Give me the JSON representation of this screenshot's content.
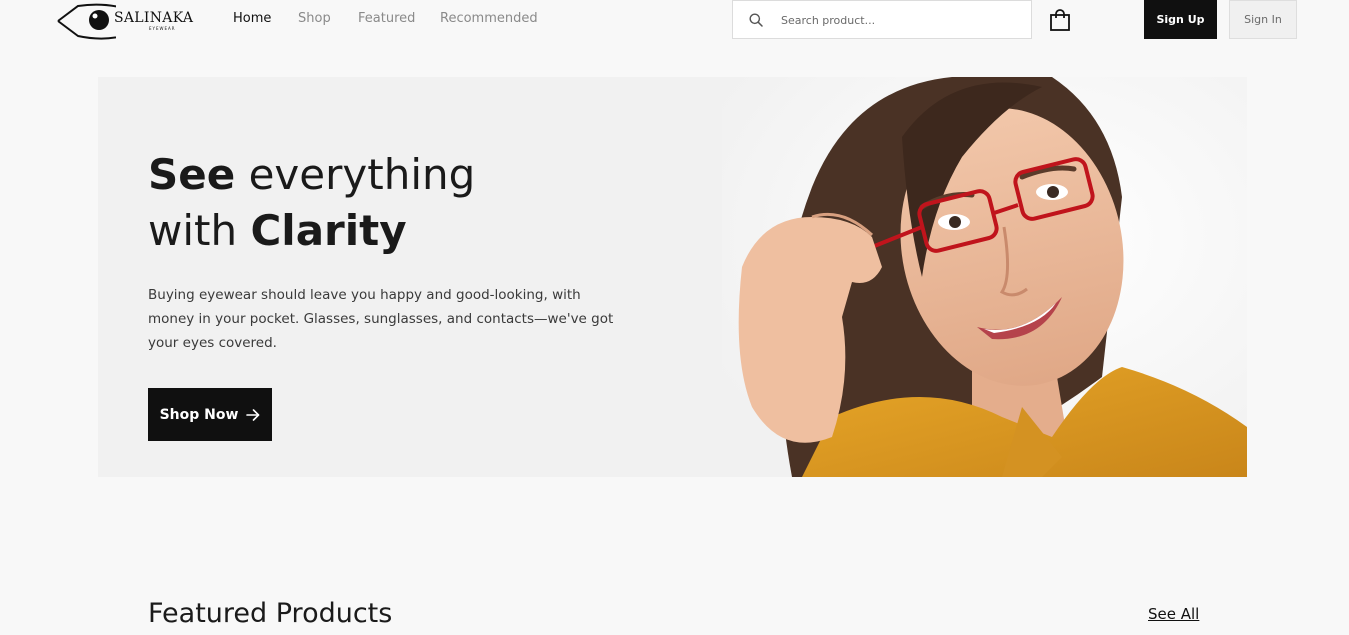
{
  "brand": {
    "name": "SALINAKA",
    "tagline": "EYEWEAR"
  },
  "nav": {
    "links": [
      {
        "label": "Home",
        "active": true
      },
      {
        "label": "Shop",
        "active": false
      },
      {
        "label": "Featured",
        "active": false
      },
      {
        "label": "Recommended",
        "active": false
      }
    ]
  },
  "search": {
    "placeholder": "Search product...",
    "value": "",
    "icon": "search-icon"
  },
  "cart": {
    "icon": "shopping-bag-icon"
  },
  "auth": {
    "signup_label": "Sign Up",
    "signin_label": "Sign In"
  },
  "hero": {
    "title_line1_bold": "See",
    "title_line1_rest": " everything",
    "title_line2_rest": "with ",
    "title_line2_bold": "Clarity",
    "description": "Buying eyewear should leave you happy and good-looking, with money in your pocket. Glasses, sunglasses, and contacts—we've got your eyes covered.",
    "cta_label": "Shop Now",
    "cta_icon": "arrow-right-icon"
  },
  "featured": {
    "title": "Featured Products",
    "see_all_label": "See All"
  },
  "colors": {
    "primary": "#101010",
    "background": "#f8f8f8",
    "hero_bg": "#f1f1f1",
    "muted_text": "#8a8a8a"
  }
}
